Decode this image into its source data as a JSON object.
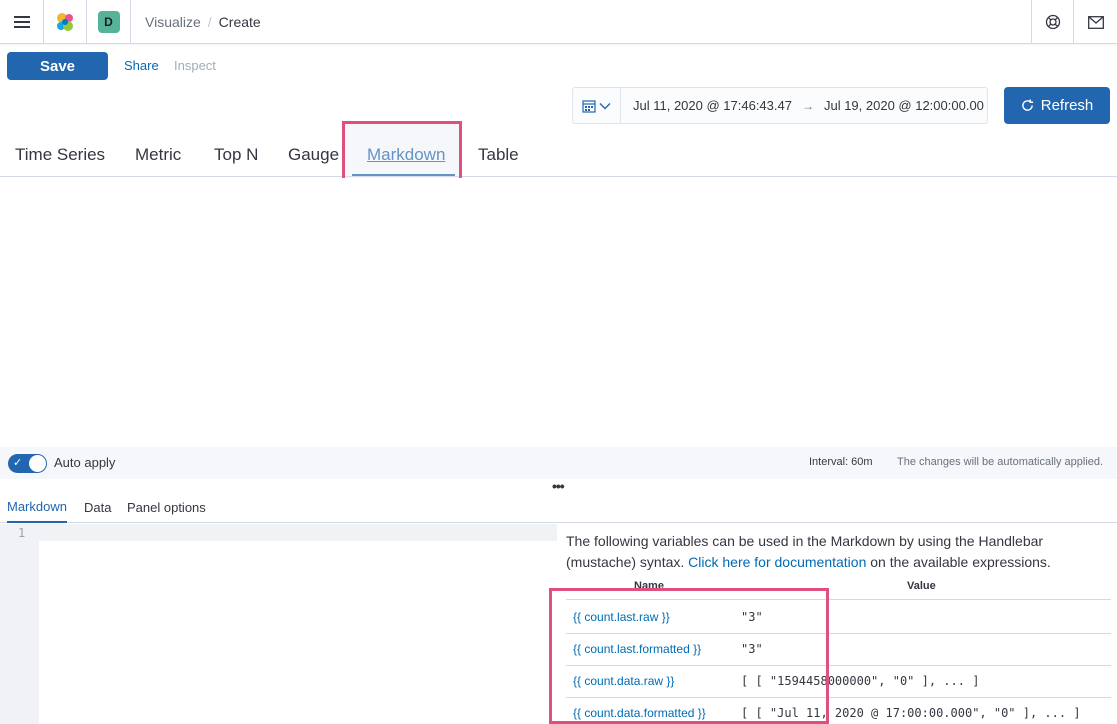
{
  "header": {
    "space_initial": "D",
    "breadcrumbs": [
      "Visualize",
      "Create"
    ]
  },
  "toolbar": {
    "save_label": "Save",
    "share_label": "Share",
    "inspect_label": "Inspect"
  },
  "timepicker": {
    "start": "Jul 11, 2020 @ 17:46:43.47",
    "arrow": "→",
    "end": "Jul 19, 2020 @ 12:00:00.00",
    "refresh_label": "Refresh"
  },
  "type_tabs": [
    {
      "label": "Time Series",
      "active": false
    },
    {
      "label": "Metric",
      "active": false
    },
    {
      "label": "Top N",
      "active": false
    },
    {
      "label": "Gauge",
      "active": false
    },
    {
      "label": "Markdown",
      "active": true
    },
    {
      "label": "Table",
      "active": false
    }
  ],
  "apply_bar": {
    "auto_apply_label": "Auto apply",
    "auto_apply_on": true,
    "interval": "Interval: 60m",
    "note": "The changes will be automatically applied."
  },
  "editor_tabs": [
    {
      "label": "Markdown",
      "active": true
    },
    {
      "label": "Data",
      "active": false
    },
    {
      "label": "Panel options",
      "active": false
    }
  ],
  "editor": {
    "line_number": "1"
  },
  "variables": {
    "intro_pre": "The following variables can be used in the Markdown by using the Handlebar (mustache) syntax. ",
    "intro_link": "Click here for documentation",
    "intro_post": " on the available expressions.",
    "col_name": "Name",
    "col_value": "Value",
    "rows": [
      {
        "name": "{{ count.last.raw }}",
        "value": "\"3\""
      },
      {
        "name": "{{ count.last.formatted }}",
        "value": "\"3\""
      },
      {
        "name": "{{ count.data.raw }}",
        "value": "[ [ \"1594458000000\", \"0\" ], ... ]"
      },
      {
        "name": "{{ count.data.formatted }}",
        "value": "[ [ \"Jul 11, 2020 @ 17:00:00.000\", \"0\" ], ... ]"
      }
    ]
  },
  "colors": {
    "primary": "#2166ae",
    "link": "#006bb4",
    "highlight": "#e0507f"
  }
}
